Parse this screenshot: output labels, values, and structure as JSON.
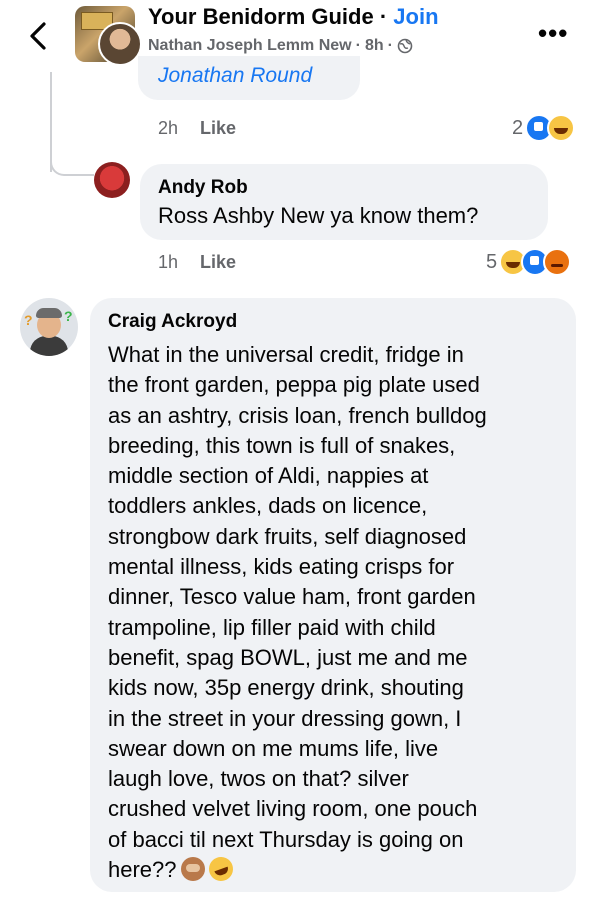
{
  "header": {
    "group_name": "Your Benidorm Guide",
    "separator": "·",
    "join_label": "Join",
    "author": "Nathan Joseph Lemm New",
    "subline_sep1": "·",
    "time": "8h",
    "subline_sep2": "·",
    "privacy_icon": "globe-icon",
    "back_icon": "chevron-left-icon",
    "more_icon": "more-dots-icon",
    "more_label": "•••"
  },
  "comments": [
    {
      "text_fragment": "Jonathan Round",
      "time": "2h",
      "like_label": "Like",
      "reaction_count": "2",
      "reactions": [
        "like",
        "haha"
      ]
    },
    {
      "name": "Andy Rob",
      "text": "Ross Ashby New ya know them?",
      "time": "1h",
      "like_label": "Like",
      "reaction_count": "5",
      "reactions": [
        "haha",
        "like",
        "angry"
      ]
    },
    {
      "name": "Craig Ackroyd",
      "text": "What in the universal credit, fridge in\nthe front garden, peppa pig plate used\nas an ashtry, crisis loan, french bulldog\nbreeding, this town is full of snakes,\nmiddle section of Aldi, nappies at\ntoddlers ankles, dads on licence,\nstrongbow dark fruits, self diagnosed\nmental illness, kids eating crisps for\ndinner, Tesco value ham, front garden\ntrampoline, lip filler paid with child\nbenefit, spag BOWL, just me and me\nkids now, 35p energy drink, shouting\nin the street in your dressing gown, I\nswear down on me mums life, live\nlaugh love, twos on that? silver\ncrushed velvet living room, one pouch\nof bacci til next Thursday is going on\nhere??",
      "emojis": [
        "see-no-evil-monkey-icon",
        "rolling-laughing-icon"
      ]
    }
  ],
  "colors": {
    "accent": "#1877f2",
    "bubble": "#f0f2f5",
    "meta_text": "#65676b"
  }
}
